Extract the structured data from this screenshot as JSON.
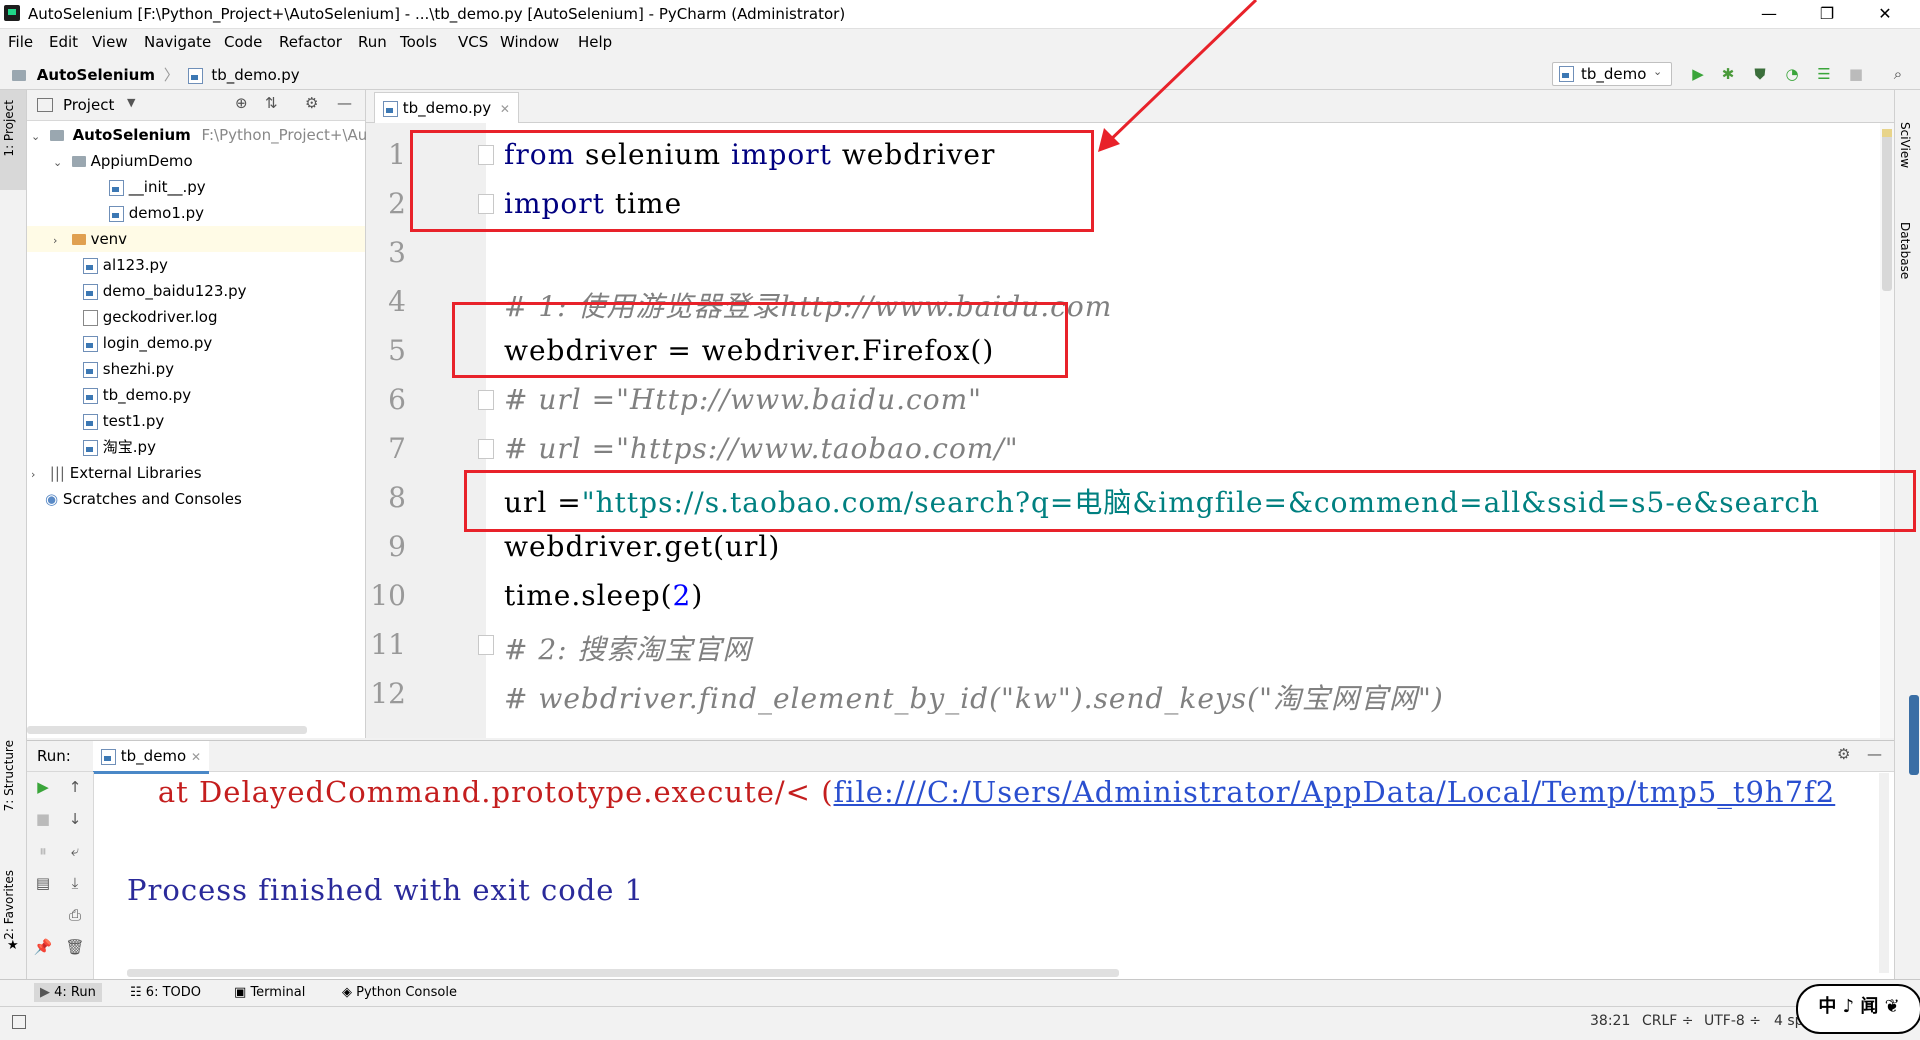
{
  "window": {
    "title": "AutoSelenium [F:\\Python_Project+\\AutoSelenium] - ...\\tb_demo.py [AutoSelenium] - PyCharm (Administrator)",
    "minimize": "—",
    "restore": "❐",
    "close": "✕"
  },
  "menu": [
    "File",
    "Edit",
    "View",
    "Navigate",
    "Code",
    "Refactor",
    "Run",
    "Tools",
    "VCS",
    "Window",
    "Help"
  ],
  "breadcrumb": {
    "project": "AutoSelenium",
    "file": "tb_demo.py",
    "sep": "〉"
  },
  "run_config": {
    "label": "tb_demo"
  },
  "toolbar_icons": [
    "run-icon",
    "debug-icon",
    "coverage-icon",
    "profile-icon",
    "concurrency-icon",
    "stop-icon",
    "search-everywhere-icon"
  ],
  "left_strip": {
    "project": "1: Project",
    "structure": "7: Structure",
    "favorites": "2: Favorites"
  },
  "right_strip": {
    "sciview": "SciView",
    "database": "Database"
  },
  "project_panel": {
    "title": "Project",
    "root": {
      "name": "AutoSelenium",
      "path": "F:\\Python_Project+\\Aut"
    },
    "items": [
      {
        "label": "AppiumDemo"
      },
      {
        "label": "__init__.py"
      },
      {
        "label": "demo1.py"
      },
      {
        "label": "venv"
      },
      {
        "label": "al123.py"
      },
      {
        "label": "demo_baidu123.py"
      },
      {
        "label": "geckodriver.log"
      },
      {
        "label": "login_demo.py"
      },
      {
        "label": "shezhi.py"
      },
      {
        "label": "tb_demo.py"
      },
      {
        "label": "test1.py"
      },
      {
        "label": "淘宝.py"
      },
      {
        "label": "External Libraries"
      },
      {
        "label": "Scratches and Consoles"
      }
    ]
  },
  "editor": {
    "tab": "tb_demo.py",
    "line_numbers": [
      "1",
      "2",
      "3",
      "4",
      "5",
      "6",
      "7",
      "8",
      "9",
      "10",
      "11",
      "12"
    ],
    "lines": [
      {
        "k1": "from",
        "t1": " selenium ",
        "k2": "import",
        "t2": " webdriver"
      },
      {
        "k1": "import",
        "t1": " time"
      },
      {},
      {
        "c": "# 1: 使用游览器登录http://www.baidu.com"
      },
      {
        "t": "webdriver = webdriver.Firefox()"
      },
      {
        "c": "# url =\"Http://www.baidu.com\""
      },
      {
        "c": "# url =\"https://www.taobao.com/\""
      },
      {
        "t": "url =",
        "s": "\"https://s.taobao.com/search?q=电脑&imgfile=&commend=all&ssid=s5-e&search"
      },
      {
        "t": "webdriver.get(url)"
      },
      {
        "t": "time.sleep(",
        "n": "2",
        "t2": ")"
      },
      {
        "c": "# 2: 搜索淘宝官网"
      },
      {
        "c": "# webdriver.find_element_by_id(\"kw\").send_keys(\"淘宝网官网\")"
      }
    ]
  },
  "run_panel": {
    "label": "Run:",
    "tab": "tb_demo",
    "line1_prefix": "    at DelayedCommand.prototype.execute/< (",
    "line1_link": "file:///C:/Users/Administrator/AppData/Local/Temp/tmp5_t9h7f2",
    "line2": "Process finished with exit code 1"
  },
  "bottom_tabs": [
    "4: Run",
    "6: TODO",
    "Terminal",
    "Python Console"
  ],
  "status": {
    "position": "38:21",
    "line_sep": "CRLF ÷",
    "encoding": "UTF-8 ÷",
    "indent": "4 sp"
  },
  "watermark": {
    "text": "中 ♪ 闻 ❦"
  },
  "colors": {
    "keyword": "#000080",
    "comment": "#808080",
    "string": "#008080",
    "number": "#0000ff",
    "annotation": "#e8222a"
  }
}
